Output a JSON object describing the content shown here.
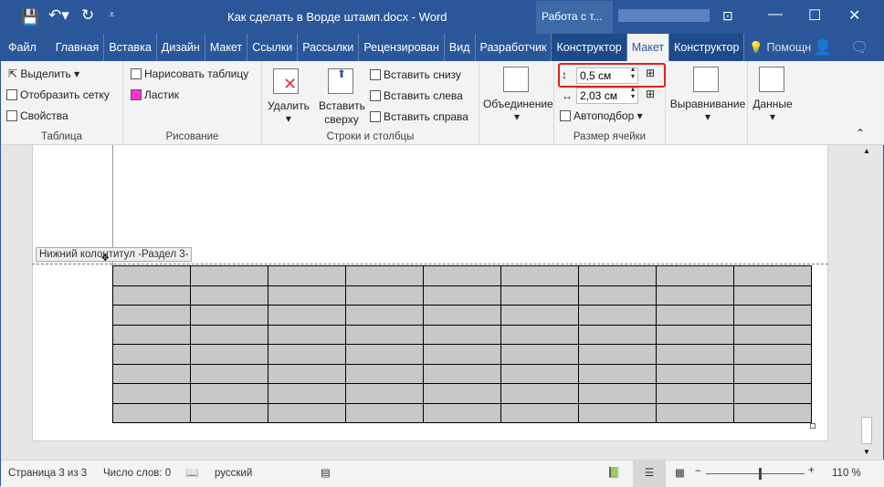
{
  "title": "Как сделать в Ворде штамп.docx - Word",
  "context_title": "Работа с т...",
  "tabs": [
    "Файл",
    "Главная",
    "Вставка",
    "Дизайн",
    "Макет",
    "Ссылки",
    "Рассылки",
    "Рецензирован",
    "Вид",
    "Разработчик",
    "Конструктор",
    "Макет",
    "Конструктор"
  ],
  "active_tab": "Макет",
  "help": "Помощн",
  "ribbon": {
    "table": {
      "label": "Таблица",
      "select": "Выделить",
      "grid": "Отобразить сетку",
      "props": "Свойства"
    },
    "draw": {
      "label": "Рисование",
      "draw_table": "Нарисовать таблицу",
      "eraser": "Ластик"
    },
    "rows": {
      "label": "Строки и столбцы",
      "delete": "Удалить",
      "insert_above": "Вставить сверху",
      "insert_below": "Вставить снизу",
      "insert_left": "Вставить слева",
      "insert_right": "Вставить справа"
    },
    "merge": "Объединение",
    "cellsize": {
      "label": "Размер ячейки",
      "height": "0,5 см",
      "width": "2,03 см",
      "autofit": "Автоподбор"
    },
    "align": "Выравнивание",
    "data": "Данные"
  },
  "footer_label": "Нижний колонтитул -Раздел 3-",
  "table": {
    "rows": 8,
    "cols": 9
  },
  "status": {
    "page": "Страница 3 из 3",
    "words": "Число слов: 0",
    "lang": "русский",
    "zoom": "110 %",
    "zoom_percent": 110
  },
  "colors": {
    "brand": "#2b579a",
    "highlight": "#e02020",
    "cell_fill": "#c8c8c8"
  }
}
